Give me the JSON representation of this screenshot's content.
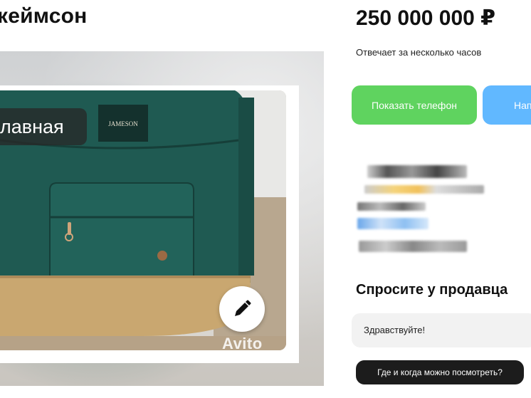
{
  "listing": {
    "title": "кеймсон",
    "badge_label": "лавная",
    "watermark": "Avito",
    "brand_patch": "JAMESON"
  },
  "sidebar": {
    "price": "250 000 000 ₽",
    "reply_time": "Отвечает за несколько часов",
    "phone_button": "Показать телефон",
    "write_button": "Нап"
  },
  "ask": {
    "title": "Спросите у продавца",
    "message": "Здравствуйте!",
    "suggestion": "Где и когда можно посмотреть?"
  },
  "icons": {
    "edit": "pencil-icon"
  },
  "colors": {
    "phone_button": "#5fd35f",
    "write_button": "#61b8ff",
    "suggestion_chip": "#1c1c1c",
    "backpack_green": "#1f5a52",
    "backpack_tan": "#c9a770"
  }
}
